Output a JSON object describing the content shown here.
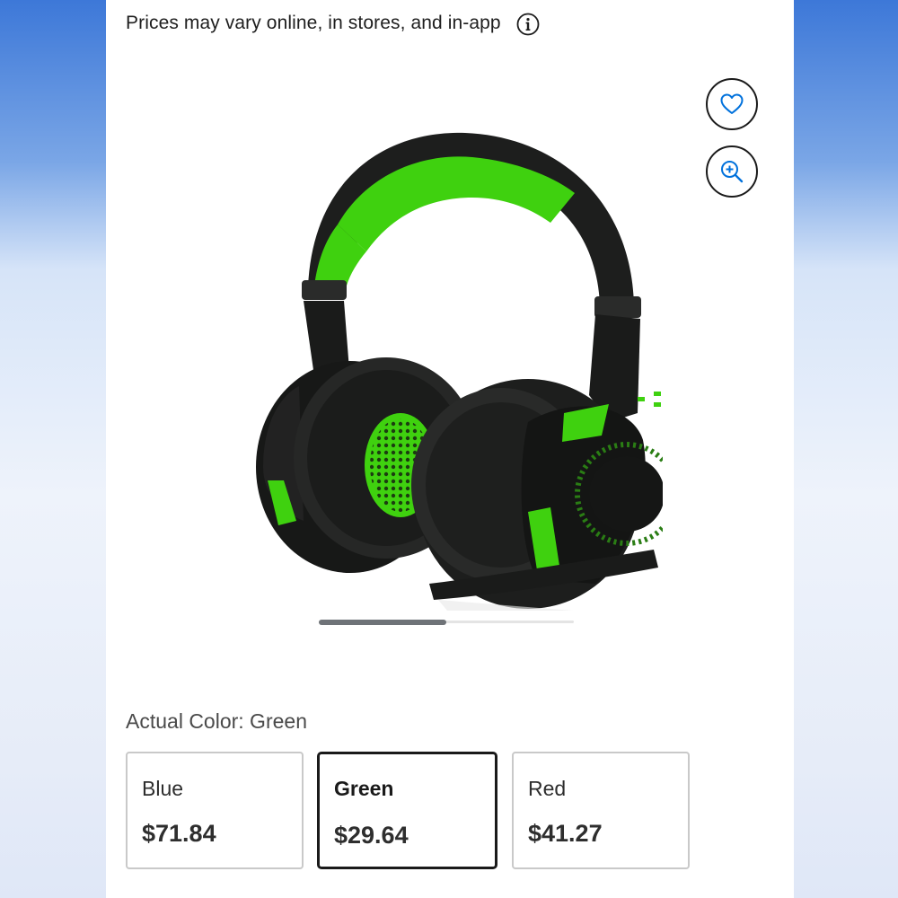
{
  "notice": {
    "text": "Prices may vary online, in stores, and in-app",
    "icon": "info-circle-icon"
  },
  "actions": {
    "favorite_icon": "heart-icon",
    "zoom_icon": "zoom-in-icon"
  },
  "product": {
    "image_description_icon": "headset-image",
    "accent_color": "#3fd10f",
    "carousel_progress": 0.5
  },
  "color_selector": {
    "label": "Actual Color: Green",
    "selected": "Green",
    "options": [
      {
        "name": "Blue",
        "price": "$71.84"
      },
      {
        "name": "Green",
        "price": "$29.64"
      },
      {
        "name": "Red",
        "price": "$41.27"
      }
    ]
  },
  "colors": {
    "brand_blue": "#0071dc",
    "text": "#2e2e2e"
  }
}
